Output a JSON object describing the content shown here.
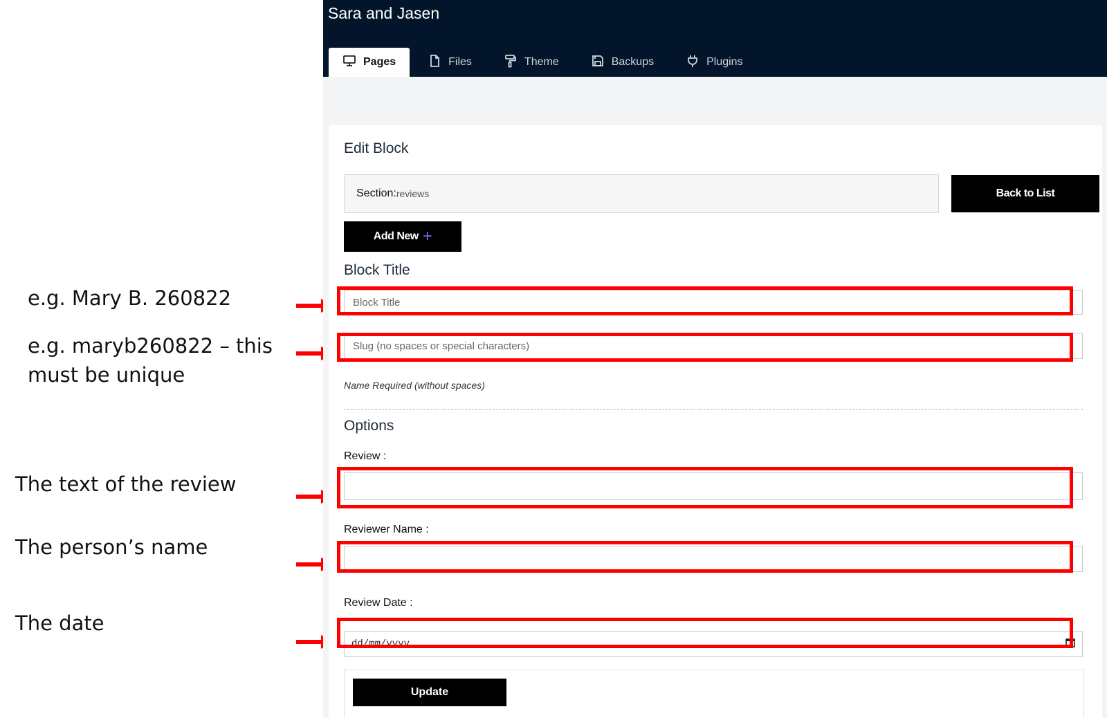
{
  "annotations": [
    {
      "text": "e.g. Mary B. 260822"
    },
    {
      "text": "e.g. maryb260822 – this must be unique"
    },
    {
      "text": "The text of the review"
    },
    {
      "text": "The person’s name"
    },
    {
      "text": "The date"
    }
  ],
  "app": {
    "site_title": "Sara and Jasen",
    "tabs": [
      {
        "label": "Pages",
        "icon": "monitor-icon",
        "active": true
      },
      {
        "label": "Files",
        "icon": "file-icon",
        "active": false
      },
      {
        "label": "Theme",
        "icon": "paint-roller-icon",
        "active": false
      },
      {
        "label": "Backups",
        "icon": "save-icon",
        "active": false
      },
      {
        "label": "Plugins",
        "icon": "plug-icon",
        "active": false
      }
    ]
  },
  "editor": {
    "title": "Edit Block",
    "section_label": "Section:",
    "section_value": "reviews",
    "back_button": "Back to List",
    "add_new_button": "Add New",
    "block_title_label": "Block Title",
    "block_title_placeholder": "Block Title",
    "slug_placeholder": "Slug (no spaces or special characters)",
    "slug_hint": "Name Required (without spaces)",
    "options_label": "Options",
    "review_label": "Review :",
    "review_value": "",
    "reviewer_name_label": "Reviewer Name :",
    "reviewer_name_value": "",
    "review_date_label": "Review Date :",
    "review_date_placeholder": "dd/mm/yyyy",
    "update_button": "Update"
  },
  "colors": {
    "topbar": "#02152a",
    "highlight": "#ff0000",
    "accent_plus": "#8a5cf6"
  }
}
